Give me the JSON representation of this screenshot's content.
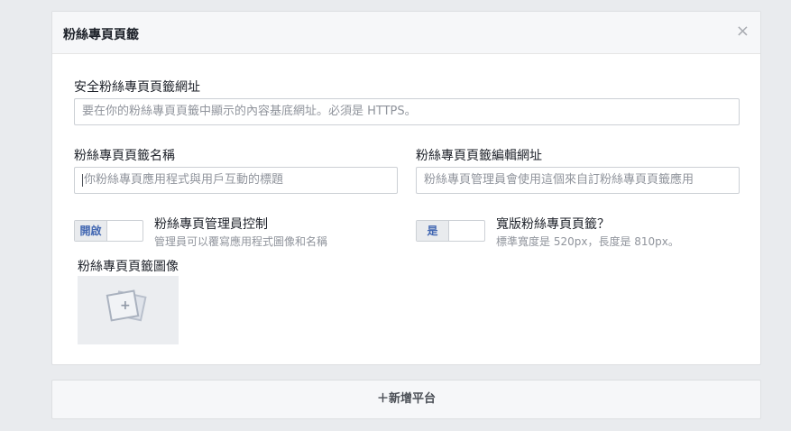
{
  "card": {
    "title": "粉絲專頁頁籤",
    "close_icon": "×"
  },
  "secure_url": {
    "label": "安全粉絲專頁頁籤網址",
    "placeholder": "要在你的粉絲專頁頁籤中顯示的內容基底網址。必須是 HTTPS。"
  },
  "tab_name": {
    "label": "粉絲專頁頁籤名稱",
    "placeholder": "你粉絲專頁應用程式與用戶互動的標題"
  },
  "edit_url": {
    "label": "粉絲專頁頁籤編輯網址",
    "placeholder": "粉絲專頁管理員會使用這個來自訂粉絲專頁頁籤應用"
  },
  "admin_control": {
    "toggle_label": "開啟",
    "title": "粉絲專頁管理員控制",
    "desc": "管理員可以覆寫應用程式圖像和名稱"
  },
  "wide_tab": {
    "toggle_label": "是",
    "title": "寬版粉絲專頁頁籤？",
    "desc": "標準寬度是 520px，長度是 810px。"
  },
  "tab_image": {
    "label": "粉絲專頁頁籤圖像",
    "icon": "image-add-icon"
  },
  "add_platform": {
    "label": "＋新增平台"
  }
}
